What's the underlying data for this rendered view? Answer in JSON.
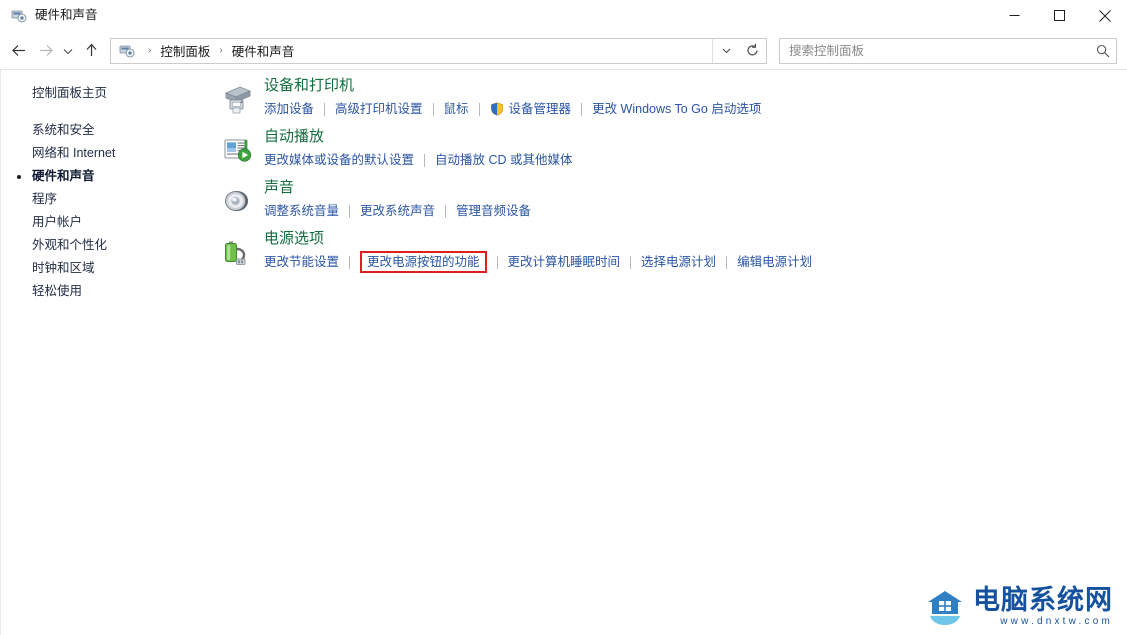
{
  "window": {
    "title": "硬件和声音",
    "icon": "control-panel-icon",
    "controls": {
      "minimize": "最小化",
      "maximize": "最大化",
      "close": "关闭"
    }
  },
  "addressbar": {
    "back": "后退",
    "forward": "前进",
    "recent": "最近使用的位置",
    "up": "向上",
    "breadcrumb": [
      "控制面板",
      "硬件和声音"
    ],
    "separator": "›",
    "dropdown": "展开",
    "refresh": "刷新"
  },
  "search": {
    "placeholder": "搜索控制面板",
    "value": "",
    "icon": "search-icon"
  },
  "sidebar": {
    "home": "控制面板主页",
    "items": [
      {
        "label": "系统和安全",
        "current": false
      },
      {
        "label": "网络和 Internet",
        "current": false
      },
      {
        "label": "硬件和声音",
        "current": true
      },
      {
        "label": "程序",
        "current": false
      },
      {
        "label": "用户帐户",
        "current": false
      },
      {
        "label": "外观和个性化",
        "current": false
      },
      {
        "label": "时钟和区域",
        "current": false
      },
      {
        "label": "轻松使用",
        "current": false
      }
    ]
  },
  "sections": [
    {
      "icon": "devices-printers-icon",
      "title": "设备和打印机",
      "links": [
        {
          "label": "添加设备",
          "shield": false,
          "highlighted": false
        },
        {
          "label": "高级打印机设置",
          "shield": false,
          "highlighted": false
        },
        {
          "label": "鼠标",
          "shield": false,
          "highlighted": false
        },
        {
          "label": "设备管理器",
          "shield": true,
          "highlighted": false
        },
        {
          "label": "更改 Windows To Go 启动选项",
          "shield": false,
          "highlighted": false
        }
      ]
    },
    {
      "icon": "autoplay-icon",
      "title": "自动播放",
      "links": [
        {
          "label": "更改媒体或设备的默认设置",
          "shield": false,
          "highlighted": false
        },
        {
          "label": "自动播放 CD 或其他媒体",
          "shield": false,
          "highlighted": false
        }
      ]
    },
    {
      "icon": "sound-icon",
      "title": "声音",
      "links": [
        {
          "label": "调整系统音量",
          "shield": false,
          "highlighted": false
        },
        {
          "label": "更改系统声音",
          "shield": false,
          "highlighted": false
        },
        {
          "label": "管理音频设备",
          "shield": false,
          "highlighted": false
        }
      ]
    },
    {
      "icon": "power-options-icon",
      "title": "电源选项",
      "links": [
        {
          "label": "更改节能设置",
          "shield": false,
          "highlighted": false
        },
        {
          "label": "更改电源按钮的功能",
          "shield": false,
          "highlighted": true
        },
        {
          "label": "更改计算机睡眠时间",
          "shield": false,
          "highlighted": false
        },
        {
          "label": "选择电源计划",
          "shield": false,
          "highlighted": false
        },
        {
          "label": "编辑电源计划",
          "shield": false,
          "highlighted": false
        }
      ]
    }
  ],
  "watermark": {
    "title": "电脑系统网",
    "url": "www.dnxtw.com",
    "logo": "house-logo-icon"
  },
  "colors": {
    "section_title": "#156e3f",
    "link": "#2a55a5",
    "highlight_border": "#e02020",
    "sidebar_text": "#1f2a44",
    "watermark": "#15519e"
  }
}
